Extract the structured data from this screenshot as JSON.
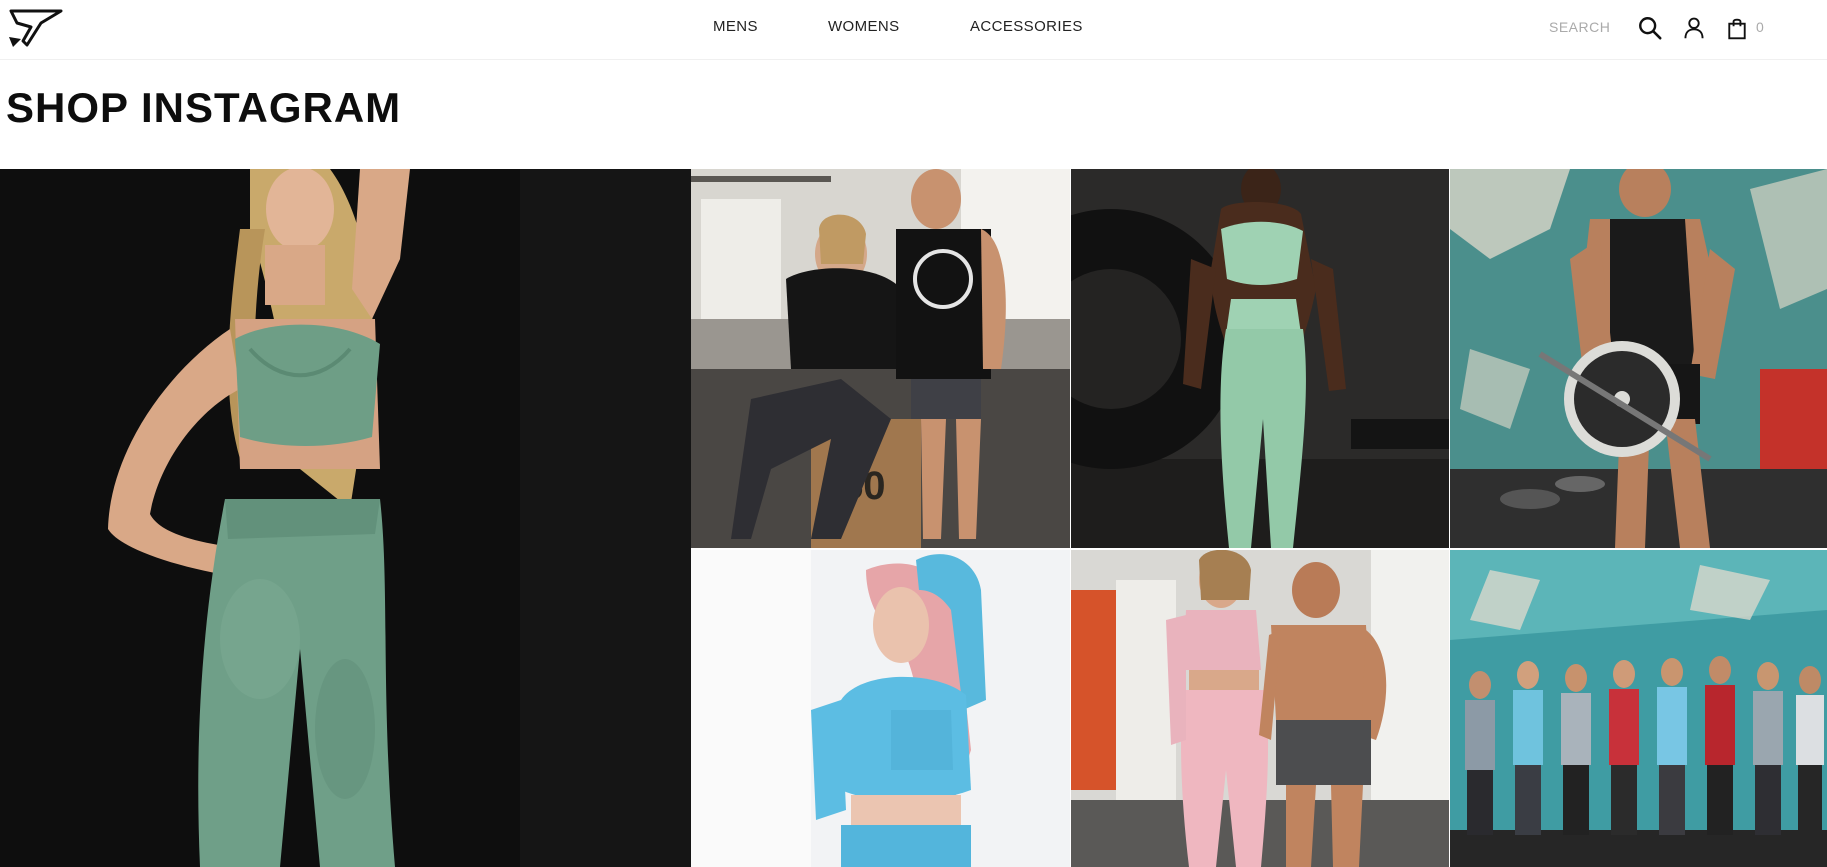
{
  "header": {
    "logo_icon": "gymshark-shark-logo",
    "nav": [
      {
        "label": "MENS"
      },
      {
        "label": "WOMENS"
      },
      {
        "label": "ACCESSORIES"
      }
    ],
    "search_label": "SEARCH",
    "search_icon": "search-icon",
    "account_icon": "user-icon",
    "bag_icon": "shopping-bag-icon",
    "bag_count": "0"
  },
  "page": {
    "title": "SHOP INSTAGRAM"
  },
  "gallery": {
    "tiles": [
      {
        "subject": "woman in sage green camo seamless crop top and leggings against black wall"
      },
      {
        "subject": "woman and man in black gymshark tops posing on wooden box in gym"
      },
      {
        "subject": "woman in mint green crop top and leggings beside large tire"
      },
      {
        "subject": "man in black tank lifting weight plate against teal wall"
      },
      {
        "subject": "woman with pink hair in light blue long-sleeve seamless top"
      },
      {
        "subject": "woman in pink seamless set and shirtless man in grey shorts"
      },
      {
        "subject": "group of men in colorful tanks lined up against teal wall"
      }
    ]
  },
  "colors": {
    "background": "#ffffff",
    "text": "#111111",
    "muted": "#aaaaaa"
  }
}
